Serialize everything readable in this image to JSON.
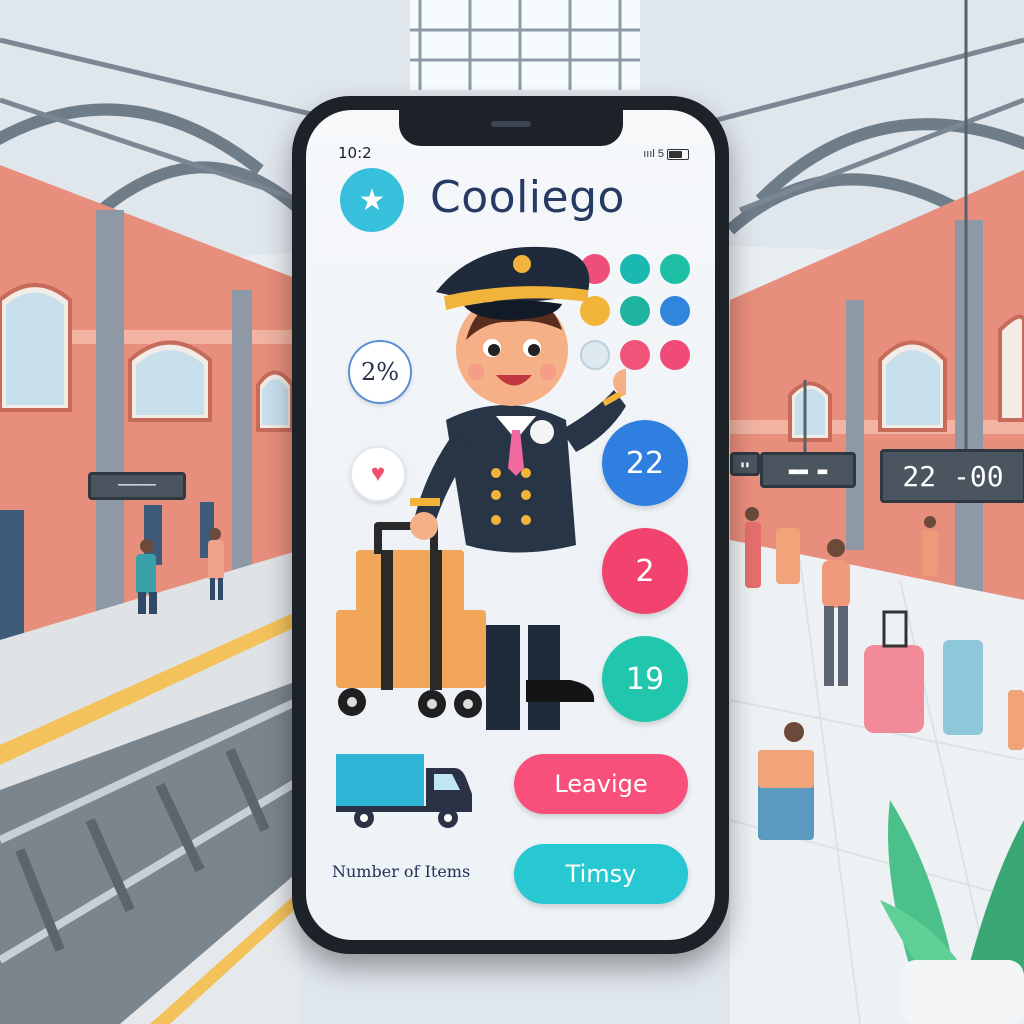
{
  "status_bar": {
    "time": "10:2",
    "indicators": "ıııl 5"
  },
  "app": {
    "title": "Cooliego",
    "logo_icon": "star-icon"
  },
  "badges": {
    "count": "2%",
    "favorite_icon": "heart-icon"
  },
  "stat_circles": [
    {
      "value": "22",
      "color": "#2f7fe0"
    },
    {
      "value": "2",
      "color": "#f2426e"
    },
    {
      "value": "19",
      "color": "#21c7ad"
    }
  ],
  "dots": [
    {
      "color": "#ee4f7a"
    },
    {
      "color": "#19b9b1"
    },
    {
      "color": "#1fbfa5"
    },
    {
      "color": "#f3b43a"
    },
    {
      "color": "#1fb49d"
    },
    {
      "color": "#2f86dc"
    },
    {
      "color": "#dfe9f0"
    },
    {
      "color": "#f25479"
    },
    {
      "color": "#f04a76"
    }
  ],
  "delivery": {
    "truck_icon": "truck-icon",
    "label": "Number of Items"
  },
  "actions": {
    "primary": {
      "label": "Leavige",
      "color": "#f8507a"
    },
    "secondary": {
      "label": "Timsy",
      "color": "#28c8d2"
    }
  },
  "background": {
    "departure_board": "22 -00"
  }
}
